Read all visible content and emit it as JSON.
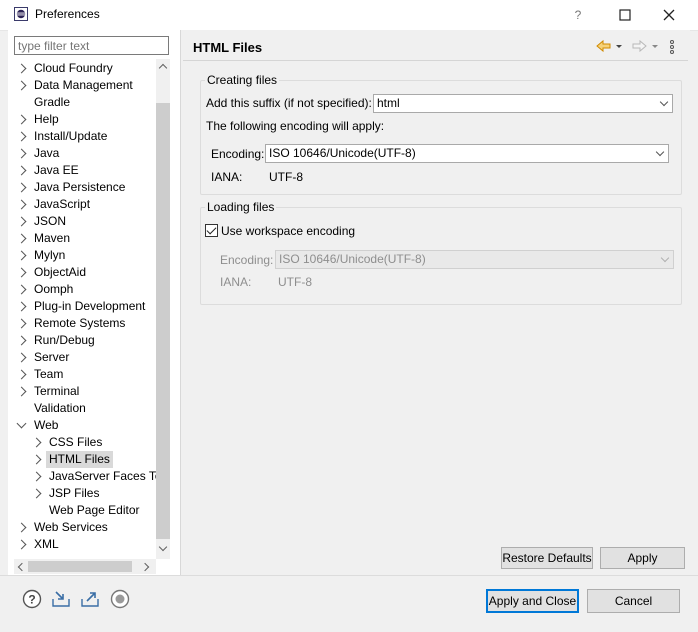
{
  "window": {
    "title": "Preferences",
    "help_glyph": "?",
    "maximize_glyph": "☐",
    "close_glyph": "✕"
  },
  "sidebar": {
    "filter_placeholder": "type filter text",
    "items": [
      {
        "label": "Cloud Foundry",
        "expander": "closed",
        "depth": 0
      },
      {
        "label": "Data Management",
        "expander": "closed",
        "depth": 0
      },
      {
        "label": "Gradle",
        "expander": "none",
        "depth": 0
      },
      {
        "label": "Help",
        "expander": "closed",
        "depth": 0
      },
      {
        "label": "Install/Update",
        "expander": "closed",
        "depth": 0
      },
      {
        "label": "Java",
        "expander": "closed",
        "depth": 0
      },
      {
        "label": "Java EE",
        "expander": "closed",
        "depth": 0
      },
      {
        "label": "Java Persistence",
        "expander": "closed",
        "depth": 0
      },
      {
        "label": "JavaScript",
        "expander": "closed",
        "depth": 0
      },
      {
        "label": "JSON",
        "expander": "closed",
        "depth": 0
      },
      {
        "label": "Maven",
        "expander": "closed",
        "depth": 0
      },
      {
        "label": "Mylyn",
        "expander": "closed",
        "depth": 0
      },
      {
        "label": "ObjectAid",
        "expander": "closed",
        "depth": 0
      },
      {
        "label": "Oomph",
        "expander": "closed",
        "depth": 0
      },
      {
        "label": "Plug-in Development",
        "expander": "closed",
        "depth": 0
      },
      {
        "label": "Remote Systems",
        "expander": "closed",
        "depth": 0
      },
      {
        "label": "Run/Debug",
        "expander": "closed",
        "depth": 0
      },
      {
        "label": "Server",
        "expander": "closed",
        "depth": 0
      },
      {
        "label": "Team",
        "expander": "closed",
        "depth": 0
      },
      {
        "label": "Terminal",
        "expander": "closed",
        "depth": 0
      },
      {
        "label": "Validation",
        "expander": "none",
        "depth": 0
      },
      {
        "label": "Web",
        "expander": "open",
        "depth": 0
      },
      {
        "label": "CSS Files",
        "expander": "closed",
        "depth": 1
      },
      {
        "label": "HTML Files",
        "expander": "closed",
        "depth": 1,
        "selected": true
      },
      {
        "label": "JavaServer Faces Tools",
        "expander": "closed",
        "depth": 1
      },
      {
        "label": "JSP Files",
        "expander": "closed",
        "depth": 1
      },
      {
        "label": "Web Page Editor",
        "expander": "none",
        "depth": 1
      },
      {
        "label": "Web Services",
        "expander": "closed",
        "depth": 0
      },
      {
        "label": "XML",
        "expander": "closed",
        "depth": 0
      }
    ]
  },
  "page": {
    "title": "HTML Files",
    "creating": {
      "legend": "Creating files",
      "suffix_label": "Add this suffix (if not specified):",
      "suffix_value": "html",
      "encoding_note": "The following encoding will apply:",
      "encoding_label": "Encoding:",
      "encoding_value": "ISO 10646/Unicode(UTF-8)",
      "iana_label": "IANA:",
      "iana_value": "UTF-8"
    },
    "loading": {
      "legend": "Loading files",
      "use_workspace_label": "Use workspace encoding",
      "use_workspace_checked": true,
      "encoding_label": "Encoding:",
      "encoding_value": "ISO 10646/Unicode(UTF-8)",
      "iana_label": "IANA:",
      "iana_value": "UTF-8"
    },
    "restore_defaults": "Restore Defaults",
    "apply": "Apply"
  },
  "footer": {
    "apply_close": "Apply and Close",
    "cancel": "Cancel"
  },
  "colors": {
    "accent": "#0078d7",
    "nav_arrow_active": "#e0a020",
    "nav_arrow_inactive": "#c8c8c8"
  }
}
